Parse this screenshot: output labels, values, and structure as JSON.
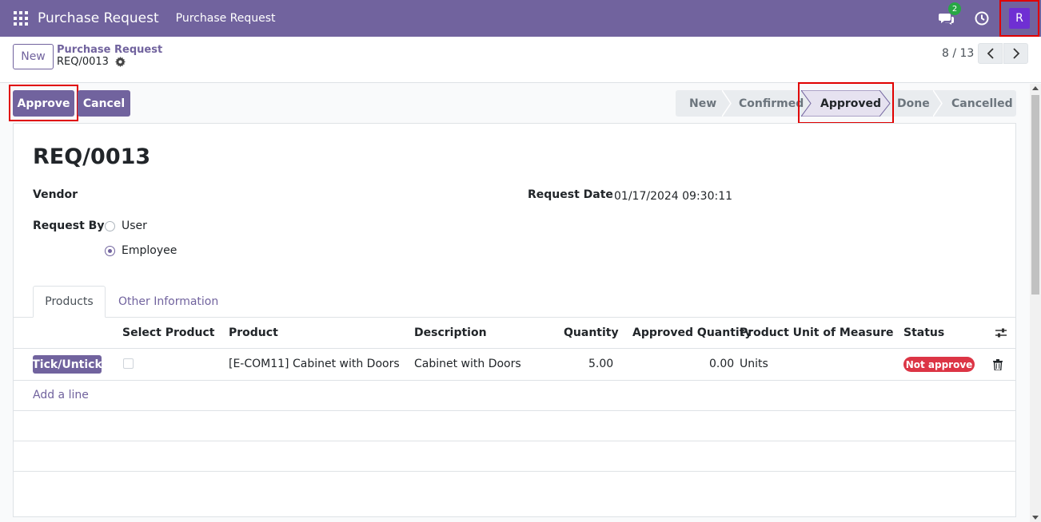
{
  "navbar": {
    "app_title": "Purchase Request",
    "menu_item": "Purchase Request",
    "chat_count": "2",
    "avatar_letter": "R"
  },
  "control_panel": {
    "new_label": "New",
    "breadcrumb_parent": "Purchase Request",
    "breadcrumb_current": "REQ/0013",
    "pager": "8 / 13"
  },
  "statusbar": {
    "approve_label": "Approve",
    "cancel_label": "Cancel",
    "stages": [
      "New",
      "Confirmed",
      "Approved",
      "Done",
      "Cancelled"
    ],
    "active_stage": "Approved"
  },
  "form": {
    "title": "REQ/0013",
    "vendor_label": "Vendor",
    "vendor_value": "",
    "request_date_label": "Request Date",
    "request_date_value": "01/17/2024 09:30:11",
    "request_by_label": "Request By",
    "request_by_options": [
      "User",
      "Employee"
    ],
    "request_by_selected": "Employee"
  },
  "tabs": [
    "Products",
    "Other Information"
  ],
  "table": {
    "headers": [
      "Select Product",
      "Product",
      "Description",
      "Quantity",
      "Approved Quantity",
      "Product Unit of Measure",
      "Status"
    ],
    "rows": [
      {
        "action_label": "Tick/Untick",
        "selected": false,
        "product": "[E-COM11] Cabinet with Doors",
        "description": "Cabinet with Doors",
        "quantity": "5.00",
        "approved_quantity": "0.00",
        "uom": "Units",
        "status": "Not approve"
      }
    ],
    "add_line_label": "Add a line"
  },
  "colors": {
    "brand": "#71639e",
    "danger": "#dc3545",
    "avatar": "#6f2fd3",
    "badge": "#28a745"
  }
}
